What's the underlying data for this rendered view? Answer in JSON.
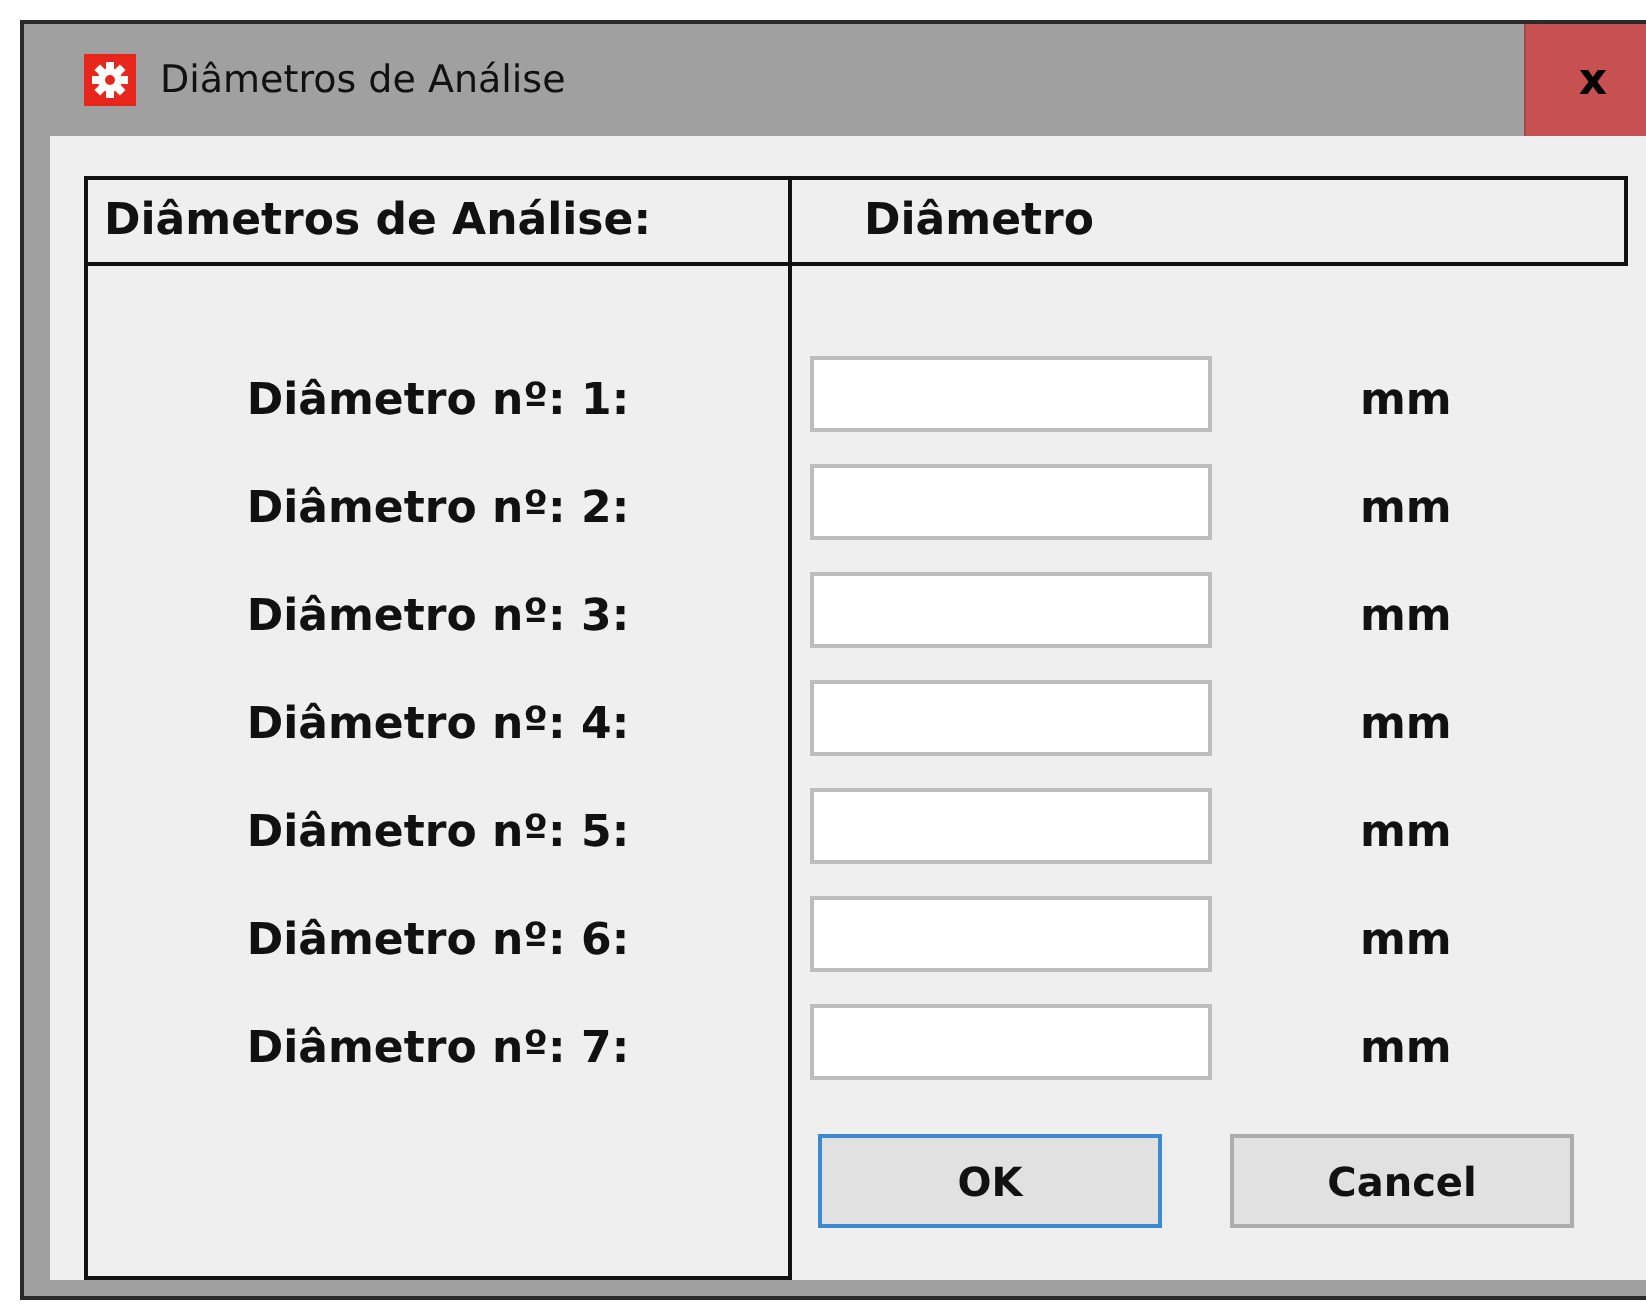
{
  "window": {
    "title": "Diâmetros de Análise",
    "close": "x"
  },
  "header": {
    "column_1": "Diâmetros de Análise:",
    "column_2": "Diâmetro"
  },
  "rows": [
    {
      "label": "Diâmetro nº: 1:",
      "unit": "mm"
    },
    {
      "label": "Diâmetro nº: 2:",
      "unit": "mm"
    },
    {
      "label": "Diâmetro nº: 3:",
      "unit": "mm"
    },
    {
      "label": "Diâmetro nº: 4:",
      "unit": "mm"
    },
    {
      "label": "Diâmetro nº: 5:",
      "unit": "mm"
    },
    {
      "label": "Diâmetro nº: 6:",
      "unit": "mm"
    },
    {
      "label": "Diâmetro nº: 7:",
      "unit": "mm"
    }
  ],
  "buttons": [
    {
      "label": "OK",
      "default": true
    },
    {
      "label": "Cancel",
      "default": false
    }
  ]
}
